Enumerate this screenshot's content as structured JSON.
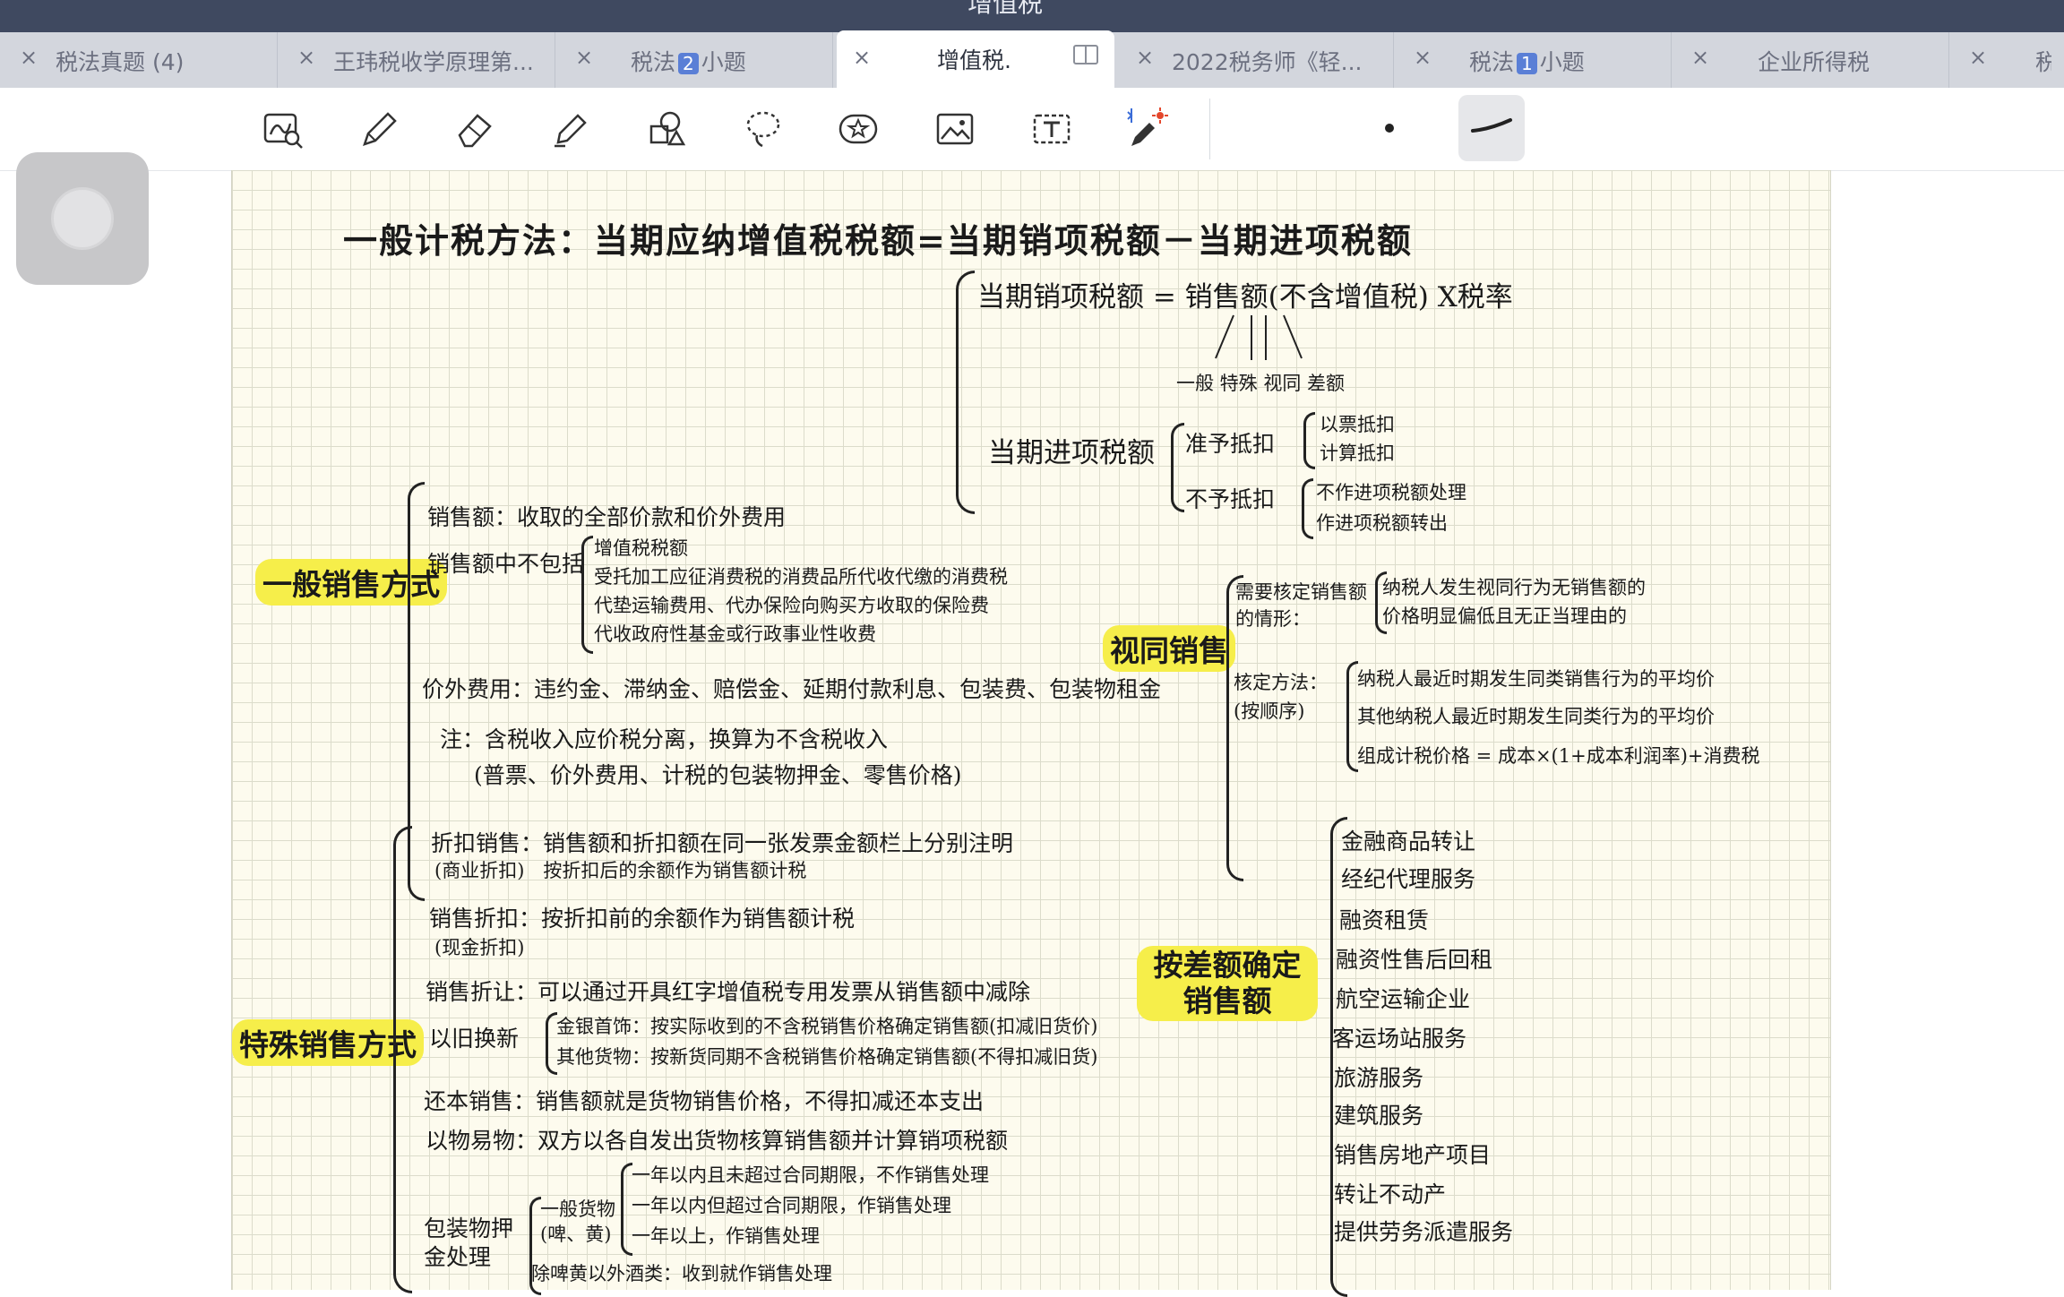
{
  "window": {
    "title": "增值税"
  },
  "tabs": [
    {
      "label": "税法真题 (4)",
      "active": false
    },
    {
      "label": "王玮税收学原理第...",
      "active": false
    },
    {
      "label_pre": "税法",
      "badge": "2",
      "label_post": "小题",
      "active": false
    },
    {
      "label": "增值税.",
      "active": true
    },
    {
      "label": "2022税务师《轻...",
      "active": false
    },
    {
      "label_pre": "税法",
      "badge": "1",
      "label_post": "小题",
      "active": false
    },
    {
      "label": "企业所得税",
      "active": false
    },
    {
      "label": "税",
      "active": false
    }
  ],
  "toolbar": {
    "tools": [
      "lasso-zoom-icon",
      "pen-icon",
      "eraser-icon",
      "highlighter-icon",
      "shapes-icon",
      "lasso-icon",
      "sticker-icon",
      "image-icon",
      "text-box-icon",
      "bluetooth-pencil-icon"
    ],
    "accent": "#5a7fd6"
  },
  "notes": {
    "title": "一般计税方法：当期应纳增值税税额=当期销项税额－当期进项税额",
    "output_tax": "当期销项税额 = 销售额(不含增值税) X税率",
    "output_tax_sub": "一般 特殊 视同 差额",
    "input_tax": "当期进项税额",
    "deductible": "准予抵扣",
    "deductible_items": [
      "以票抵扣",
      "计算抵扣"
    ],
    "non_deductible": "不予抵扣",
    "non_deductible_items": [
      "不作进项税额处理",
      "作进项税额转出"
    ],
    "general_sales": {
      "label": "一般销售方式",
      "items": [
        "销售额：收取的全部价款和价外费用",
        "销售额中不包括",
        "价外费用：违约金、滞纳金、赔偿金、延期付款利息、包装费、包装物租金",
        "注：含税收入应价税分离，换算为不含税收入",
        "(普票、价外费用、计税的包装物押金、零售价格)"
      ],
      "excluded": [
        "增值税税额",
        "受托加工应征消费税的消费品所代收代缴的消费税",
        "代垫运输费用、代办保险向购买方收取的保险费",
        "代收政府性基金或行政事业性收费"
      ]
    },
    "deemed_sales": {
      "label": "视同销售",
      "case_header": "需要核定销售额的情形：",
      "cases": [
        "纳税人发生视同行为无销售额的",
        "价格明显偏低且无正当理由的"
      ],
      "method_header": "核定方法：(按顺序)",
      "methods": [
        "纳税人最近时期发生同类销售行为的平均价",
        "其他纳税人最近时期发生同类行为的平均价",
        "组成计税价格 = 成本×(1+成本利润率)+消费税"
      ]
    },
    "special_sales": {
      "label": "特殊销售方式",
      "items": [
        "折扣销售：销售额和折扣额在同一张发票金额栏上分别注明",
        "(商业折扣)　按折扣后的余额作为销售额计税",
        "销售折扣：按折扣前的余额作为销售额计税",
        "(现金折扣)",
        "销售折让：可以通过开具红字增值税专用发票从销售额中减除",
        "以旧换新",
        "还本销售：销售额就是货物销售价格，不得扣减还本支出",
        "以物易物：双方以各自发出货物核算销售额并计算销项税额",
        "包装物押金处理"
      ],
      "trade_in": [
        "金银首饰：按实际收到的不含税销售价格确定销售额(扣减旧货价)",
        "其他货物：按新货同期不含税销售价格确定销售额(不得扣减旧货)"
      ],
      "deposit_general": "一般货物(啤、黄)",
      "deposit_rules": [
        "一年以内且未超过合同期限，不作销售处理",
        "一年以内但超过合同期限，作销售处理",
        "一年以上，作销售处理"
      ],
      "deposit_other": "除啤黄以外酒类：收到就作销售处理"
    },
    "differential": {
      "label": "按差额确定销售额",
      "items": [
        "金融商品转让",
        "经纪代理服务",
        "融资租赁",
        "融资性售后回租",
        "航空运输企业",
        "客运场站服务",
        "旅游服务",
        "建筑服务",
        "销售房地产项目",
        "转让不动产",
        "提供劳务派遣服务"
      ]
    }
  }
}
